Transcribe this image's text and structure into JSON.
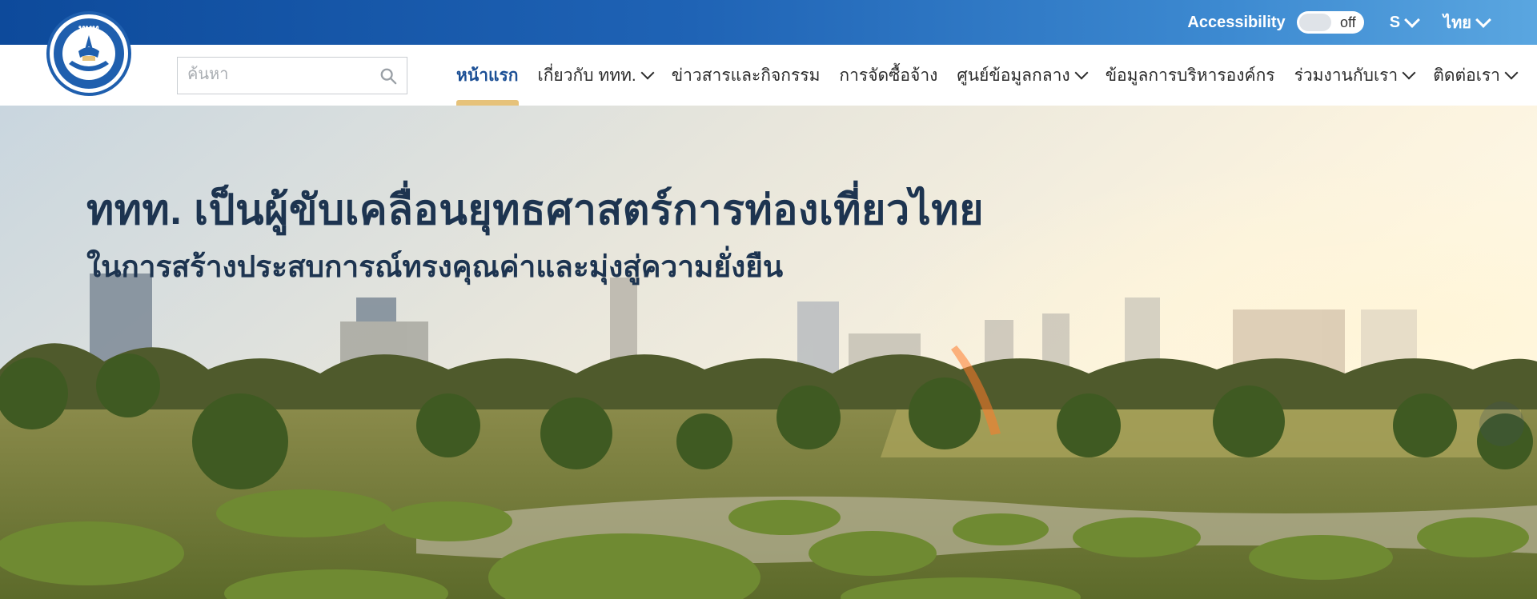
{
  "topbar": {
    "accessibility_label": "Accessibility",
    "accessibility_toggle_state": "off",
    "font_size_label": "S",
    "language_label": "ไทย"
  },
  "logo": {
    "alt": "Tourism Authority of Thailand",
    "mark_text": "ททท"
  },
  "search": {
    "placeholder": "ค้นหา",
    "value": ""
  },
  "nav": {
    "items": [
      {
        "label": "หน้าแรก",
        "active": true,
        "dropdown": false
      },
      {
        "label": "เกี่ยวกับ ททท.",
        "active": false,
        "dropdown": true
      },
      {
        "label": "ข่าวสารและกิจกรรม",
        "active": false,
        "dropdown": false
      },
      {
        "label": "การจัดซื้อจ้าง",
        "active": false,
        "dropdown": false
      },
      {
        "label": "ศูนย์ข้อมูลกลาง",
        "active": false,
        "dropdown": true
      },
      {
        "label": "ข้อมูลการบริหารองค์กร",
        "active": false,
        "dropdown": false
      },
      {
        "label": "ร่วมงานกับเรา",
        "active": false,
        "dropdown": true
      },
      {
        "label": "ติดต่อเรา",
        "active": false,
        "dropdown": true
      }
    ]
  },
  "hero": {
    "headline": "ททท. เป็นผู้ขับเคลื่อนยุทธศาสตร์การท่องเที่ยวไทย",
    "subline": "ในการสร้างประสบการณ์ทรงคุณค่าและมุ่งสู่ความยั่งยืน"
  },
  "colors": {
    "topbar_start": "#0d4a9b",
    "topbar_end": "#5aa6e0",
    "nav_active": "#1b4f95",
    "nav_active_underline": "#e6c27a",
    "headline": "#1d3450"
  },
  "icons": {
    "search": "search-icon",
    "dropdown": "chevron-down-icon",
    "toggle": "toggle-switch"
  }
}
